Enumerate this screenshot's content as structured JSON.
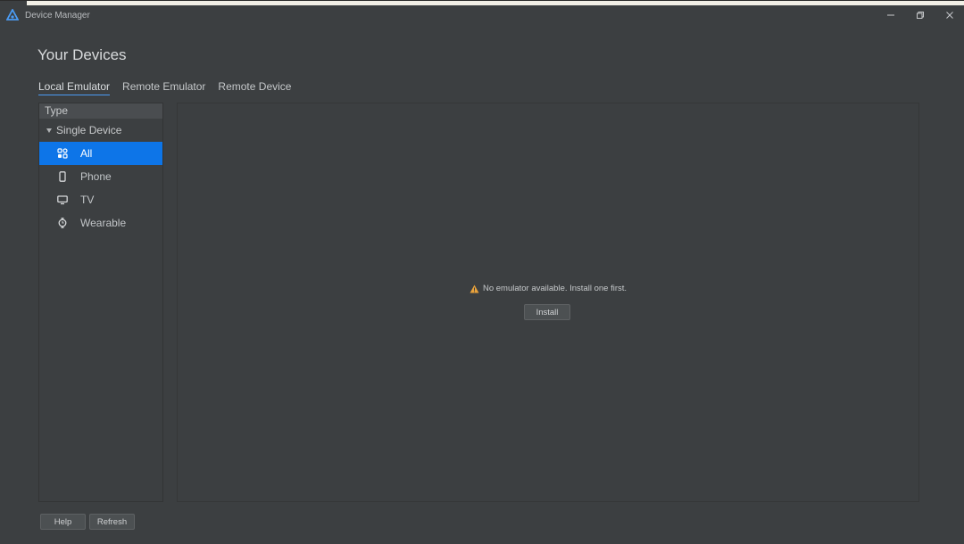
{
  "window": {
    "title": "Device Manager",
    "controls": {
      "minimize": "—",
      "restore": "❐",
      "close": "✕"
    }
  },
  "page": {
    "title": "Your Devices"
  },
  "tabs": [
    {
      "label": "Local Emulator",
      "active": true
    },
    {
      "label": "Remote Emulator",
      "active": false
    },
    {
      "label": "Remote Device",
      "active": false
    }
  ],
  "sidebar": {
    "header": "Type",
    "group": "Single Device",
    "items": [
      {
        "label": "All",
        "icon": "grid-icon",
        "selected": true
      },
      {
        "label": "Phone",
        "icon": "phone-icon",
        "selected": false
      },
      {
        "label": "TV",
        "icon": "tv-icon",
        "selected": false
      },
      {
        "label": "Wearable",
        "icon": "watch-icon",
        "selected": false
      }
    ]
  },
  "main": {
    "message": "No emulator available. Install one first.",
    "install_label": "Install"
  },
  "footer": {
    "help_label": "Help",
    "refresh_label": "Refresh"
  },
  "colors": {
    "accent": "#0d75e8",
    "warning": "#e9a23b",
    "background": "#3c3f41"
  }
}
